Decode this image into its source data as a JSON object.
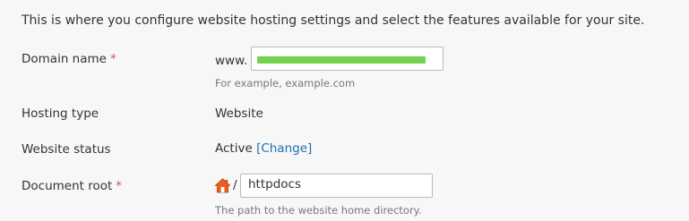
{
  "intro": "This is where you configure website hosting settings and select the features available for your site.",
  "domain": {
    "label": "Domain name",
    "required_marker": "*",
    "prefix": "www.",
    "hint": "For example, example.com"
  },
  "hosting_type": {
    "label": "Hosting type",
    "value": "Website"
  },
  "website_status": {
    "label": "Website status",
    "value": "Active",
    "change_link": "[Change]"
  },
  "document_root": {
    "label": "Document root",
    "required_marker": "*",
    "separator": "/",
    "value": "httpdocs",
    "hint": "The path to the website home directory."
  },
  "colors": {
    "required": "#d9534f",
    "link": "#1a6fb1",
    "redaction": "#74d24f",
    "home_icon": "#e8601c"
  },
  "icons": {
    "home": "home-icon"
  }
}
